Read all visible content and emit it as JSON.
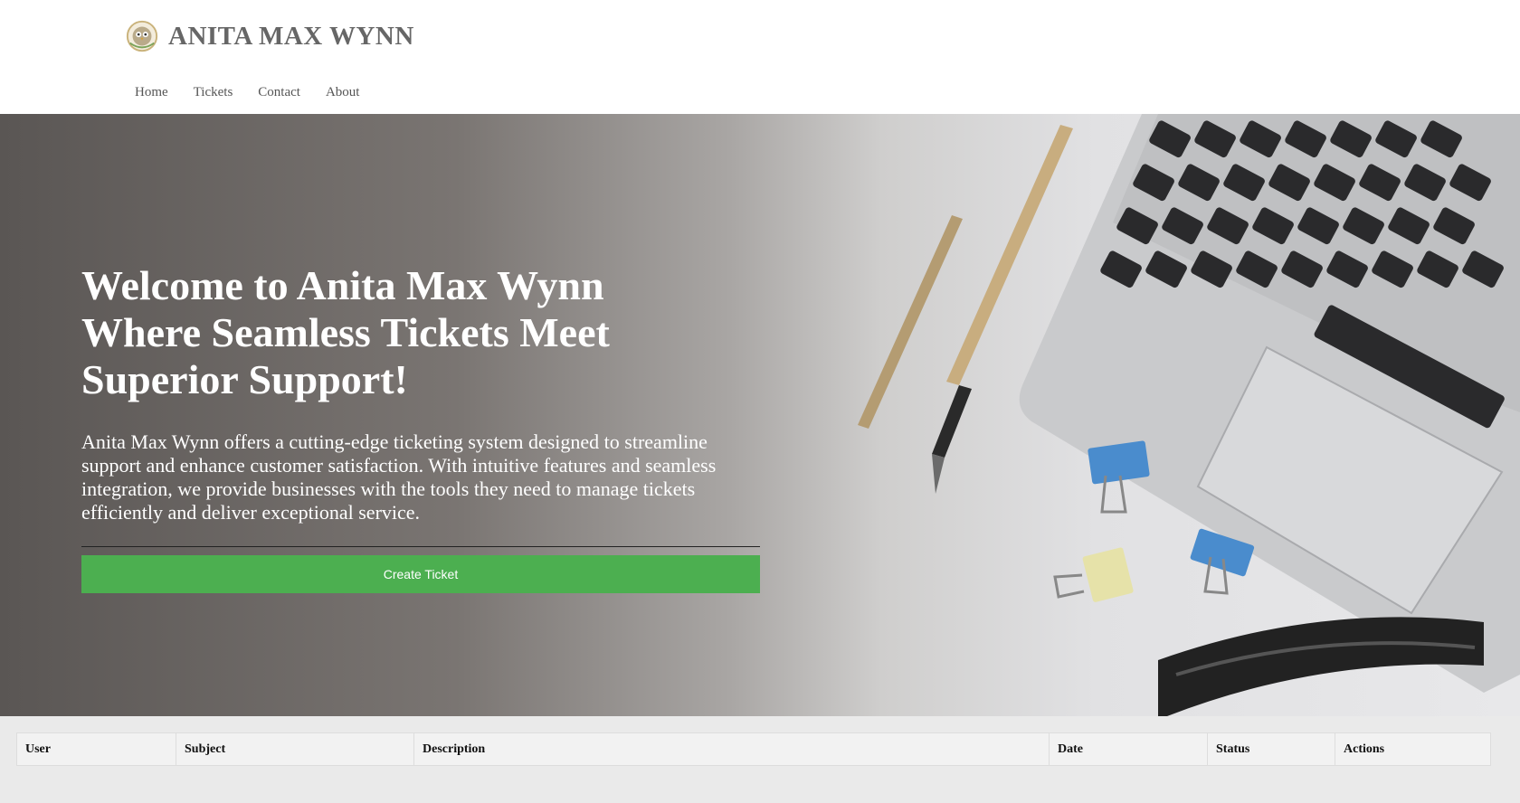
{
  "brand": {
    "name": "ANITA MAX WYNN",
    "logo_icon": "owl-crest-logo"
  },
  "nav": {
    "items": [
      "Home",
      "Tickets",
      "Contact",
      "About"
    ]
  },
  "hero": {
    "title_lines": [
      "Welcome to Anita Max Wynn",
      "Where Seamless Tickets Meet",
      "Superior Support!"
    ],
    "description": "Anita Max Wynn offers a cutting-edge ticketing system designed to streamline support and enhance customer satisfaction. With intuitive features and seamless integration, we provide businesses with the tools they need to manage tickets efficiently and deliver exceptional service.",
    "button_label": "Create Ticket",
    "button_color": "#4caf50"
  },
  "table": {
    "columns": [
      "User",
      "Subject",
      "Description",
      "Date",
      "Status",
      "Actions"
    ],
    "rows": []
  }
}
